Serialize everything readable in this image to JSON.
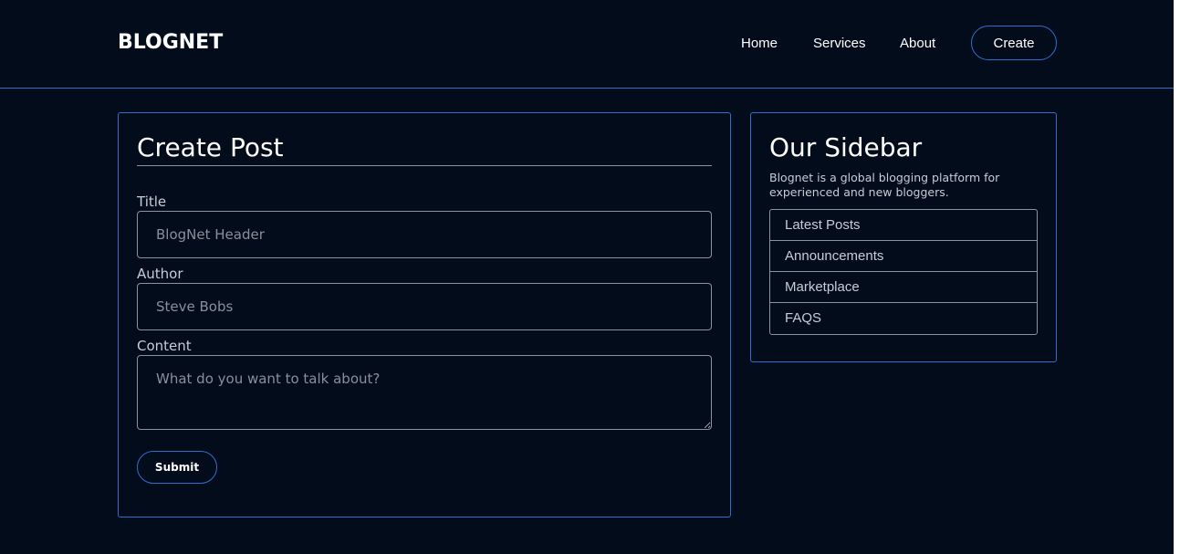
{
  "navbar": {
    "brand": "BLOGNET",
    "links": [
      {
        "label": "Home"
      },
      {
        "label": "Services"
      },
      {
        "label": "About"
      }
    ],
    "create_label": "Create"
  },
  "post_form": {
    "title": "Create Post",
    "title_label": "Title",
    "title_placeholder": "BlogNet Header",
    "author_label": "Author",
    "author_placeholder": "Steve Bobs",
    "content_label": "Content",
    "content_placeholder": "What do you want to talk about?",
    "submit_label": "Submit"
  },
  "sidebar": {
    "title": "Our Sidebar",
    "description": "Blognet is a global blogging platform for experienced and new bloggers.",
    "items": [
      {
        "label": "Latest Posts"
      },
      {
        "label": "Announcements"
      },
      {
        "label": "Marketplace"
      },
      {
        "label": "FAQS"
      }
    ]
  },
  "colors": {
    "background": "#020c1b",
    "accent": "#2f6fd1",
    "border_gray": "#8a93a3"
  }
}
